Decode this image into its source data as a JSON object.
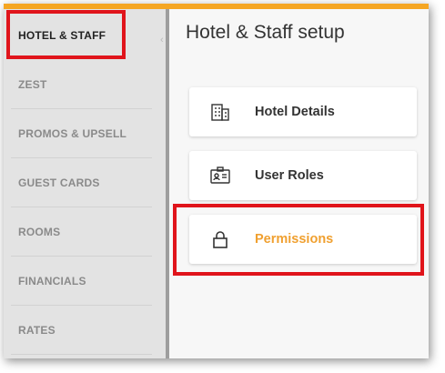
{
  "sidebar": {
    "items": [
      {
        "label": "HOTEL & STAFF",
        "active": true
      },
      {
        "label": "ZEST",
        "active": false
      },
      {
        "label": "PROMOS & UPSELL",
        "active": false
      },
      {
        "label": "GUEST CARDS",
        "active": false
      },
      {
        "label": "ROOMS",
        "active": false
      },
      {
        "label": "FINANCIALS",
        "active": false
      },
      {
        "label": "RATES",
        "active": false
      }
    ]
  },
  "main": {
    "title": "Hotel & Staff setup",
    "cards": [
      {
        "label": "Hotel Details",
        "icon": "building-icon"
      },
      {
        "label": "User Roles",
        "icon": "id-card-icon"
      },
      {
        "label": "Permissions",
        "icon": "lock-icon",
        "accent": true
      }
    ]
  },
  "colors": {
    "accent": "#f5a623",
    "highlight": "#e0141b",
    "active_text": "#222222",
    "inactive_text": "#8a8a8a"
  }
}
